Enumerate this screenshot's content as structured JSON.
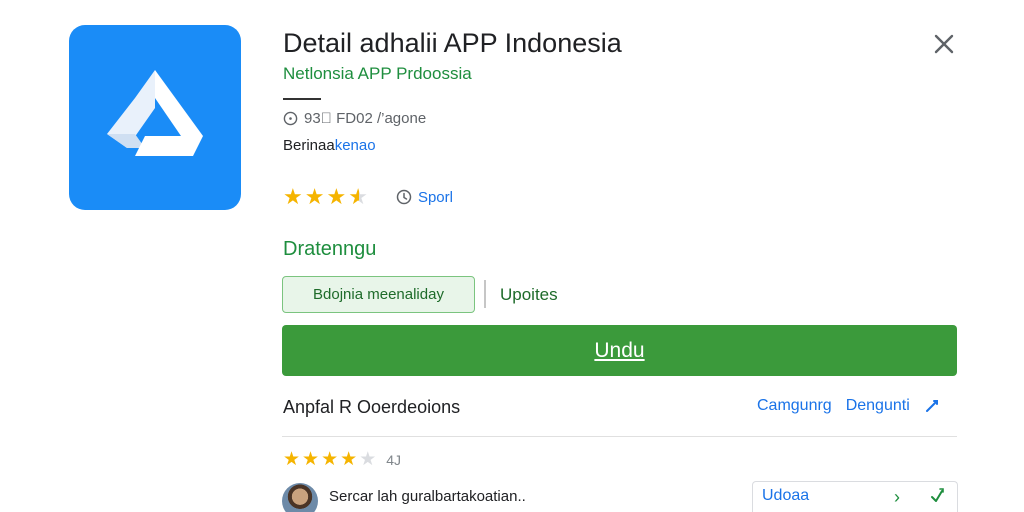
{
  "app": {
    "title": "Detail adhalii APP Indonesia",
    "developer": "Netlonsia APP Prdoossia",
    "meta": "93⃕ FD02 /’agone",
    "category_label": "Berinaa",
    "category_link": "kenao",
    "rating_value": 3.5,
    "genre_label": "Sporl"
  },
  "section": {
    "heading": "Dratenngu",
    "chip_label": "Bdojnia meenaliday",
    "updates_link": "Upoites"
  },
  "install": {
    "label": "Undu"
  },
  "reviews": {
    "heading": "Anpfal R Ooerdeoions",
    "link_1": "Camgunrg",
    "link_2": "Dengunti",
    "summary_rating": 4,
    "summary_count": "4J",
    "first_review_text": "Sercar lah guralbartakoatian..",
    "first_review_action": "Udoaa"
  },
  "colors": {
    "icon_bg": "#1a8cf7",
    "accent_green": "#3b9a3b",
    "link_blue": "#1a73e8",
    "star": "#f5b400"
  },
  "icons": [
    "app-logo-icon",
    "close-icon",
    "clock-icon",
    "info-icon",
    "edit-icon",
    "chevron-right-icon",
    "share-icon"
  ]
}
